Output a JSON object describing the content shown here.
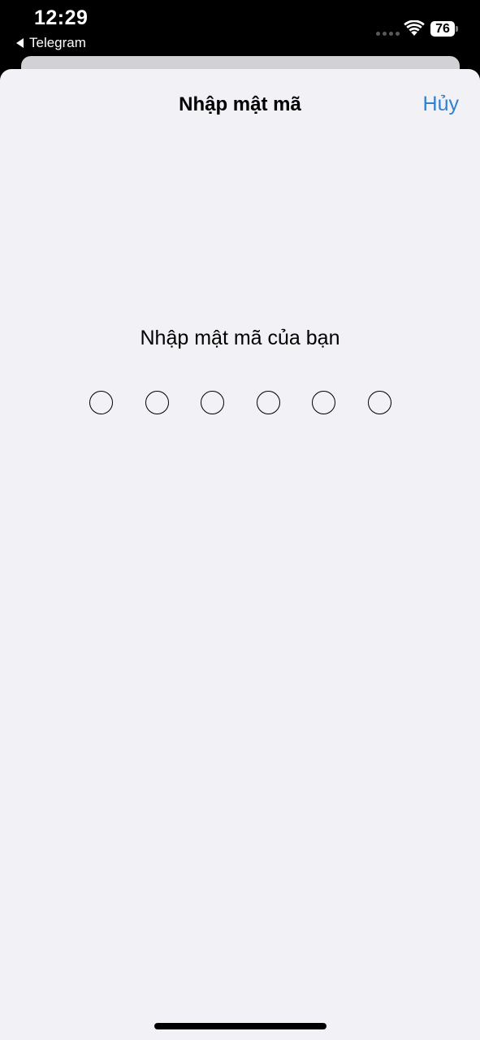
{
  "status_bar": {
    "time": "12:29",
    "back_app_label": "Telegram",
    "battery_level": "76",
    "wifi_icon": "wifi-icon",
    "cellular_icon": "signal-dots-icon"
  },
  "nav": {
    "title": "Nhập mật mã",
    "cancel_label": "Hủy"
  },
  "passcode": {
    "prompt": "Nhập mật mã của bạn",
    "length": 6,
    "entered": 0
  },
  "colors": {
    "accent": "#2f7fd3",
    "sheet_background": "#f1f1f6"
  }
}
